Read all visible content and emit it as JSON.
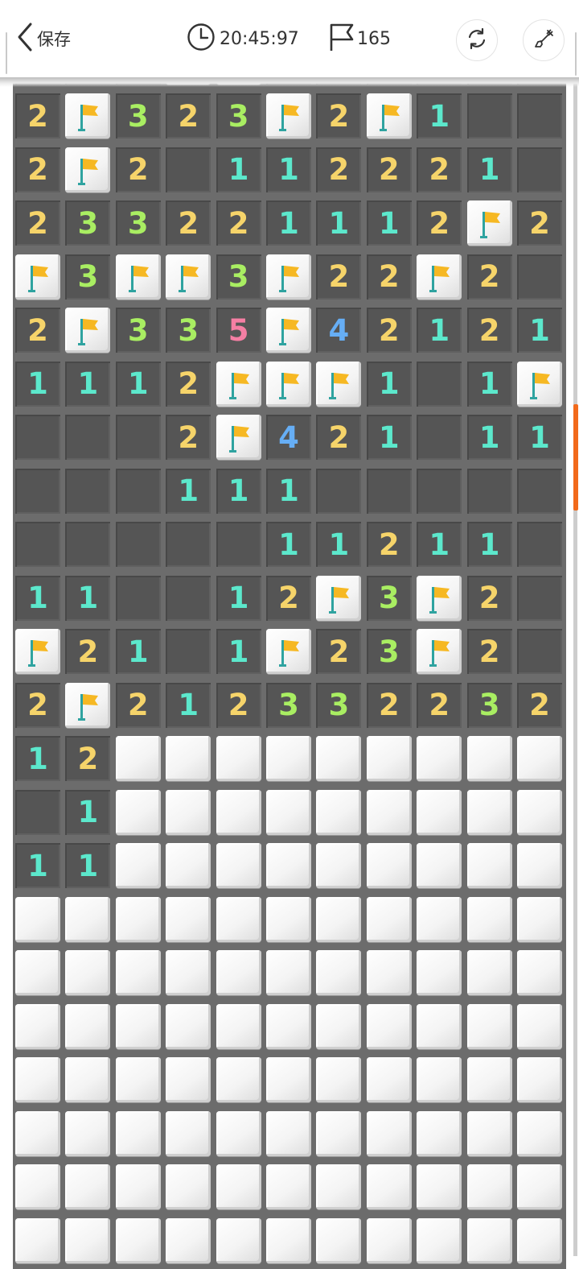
{
  "header": {
    "back_label": "保存",
    "timer": "20:45:97",
    "flag_count": "165"
  },
  "colors": {
    "1": "#5ce8cc",
    "2": "#f6d46a",
    "3": "#a9ee62",
    "4": "#66aef5",
    "5": "#f57fa4",
    "flag": "#f6b823",
    "pole": "#2fa3a0",
    "scroll_thumb": "#f26a1b"
  },
  "board": {
    "columns": 11,
    "rows": [
      "2F323F2F1..",
      "2F2.1122210",
      "233221112F2",
      "F3FF3F22F2.",
      "2F335F42121",
      "1112FFF1.1F",
      "...2F421.11",
      "...111.....",
      ".....11211.",
      "11..12F3F2.",
      "F21.1F23F2.",
      "2F212332232",
      "12#########",
      ".1#########",
      "11#########",
      "###########",
      "###########",
      "###########",
      "###########",
      "###########",
      "###########",
      "###########"
    ]
  }
}
